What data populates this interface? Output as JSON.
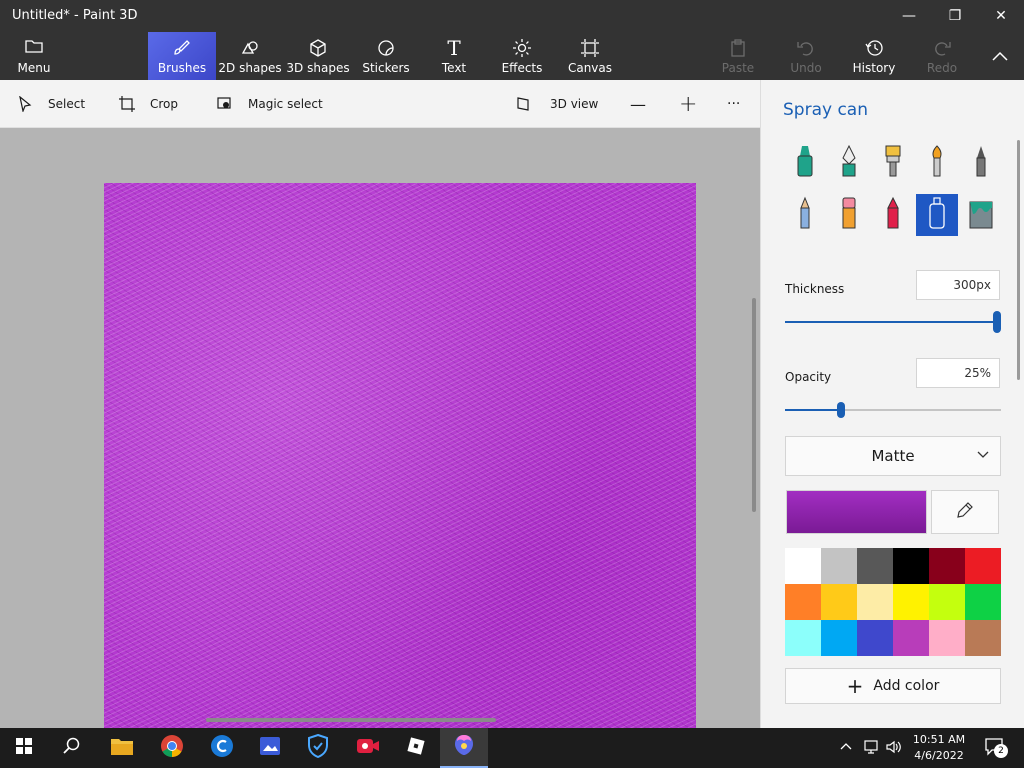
{
  "window": {
    "title": "Untitled* - Paint 3D",
    "minimize": "—",
    "restore": "❐",
    "close": "✕"
  },
  "ribbon": {
    "menu": "Menu",
    "tabs": [
      {
        "label": "Brushes",
        "icon": "brush-icon"
      },
      {
        "label": "2D shapes",
        "icon": "2d-shapes-icon"
      },
      {
        "label": "3D shapes",
        "icon": "3d-shapes-icon"
      },
      {
        "label": "Stickers",
        "icon": "stickers-icon"
      },
      {
        "label": "Text",
        "icon": "text-icon"
      },
      {
        "label": "Effects",
        "icon": "effects-icon"
      },
      {
        "label": "Canvas",
        "icon": "canvas-icon"
      }
    ],
    "paste": "Paste",
    "undo": "Undo",
    "history": "History",
    "redo": "Redo",
    "active_color": "#4a56d8"
  },
  "toolbar": {
    "select": "Select",
    "crop": "Crop",
    "magic_select": "Magic select",
    "view3d": "3D view",
    "zoom_out": "—",
    "zoom_in": "+",
    "more": "···"
  },
  "panel": {
    "title": "Spray can",
    "thickness_label": "Thickness",
    "thickness_value": "300px",
    "thickness_fraction": 1.0,
    "opacity_label": "Opacity",
    "opacity_value": "25%",
    "opacity_fraction": 0.25,
    "material": "Matte",
    "current_color": "#a22ec2",
    "palette": [
      "#ffffff",
      "#c3c3c3",
      "#585858",
      "#000000",
      "#88001b",
      "#ec1c24",
      "#ff7f27",
      "#ffca18",
      "#fdeca6",
      "#fff200",
      "#c4ff0e",
      "#0ed145",
      "#8cfffb",
      "#00a8f3",
      "#3f48cc",
      "#b83dba",
      "#ffaec8",
      "#b97a56"
    ],
    "add_color": "Add color"
  },
  "taskbar": {
    "time": "10:51 AM",
    "date": "4/6/2022",
    "notifications": "2"
  }
}
